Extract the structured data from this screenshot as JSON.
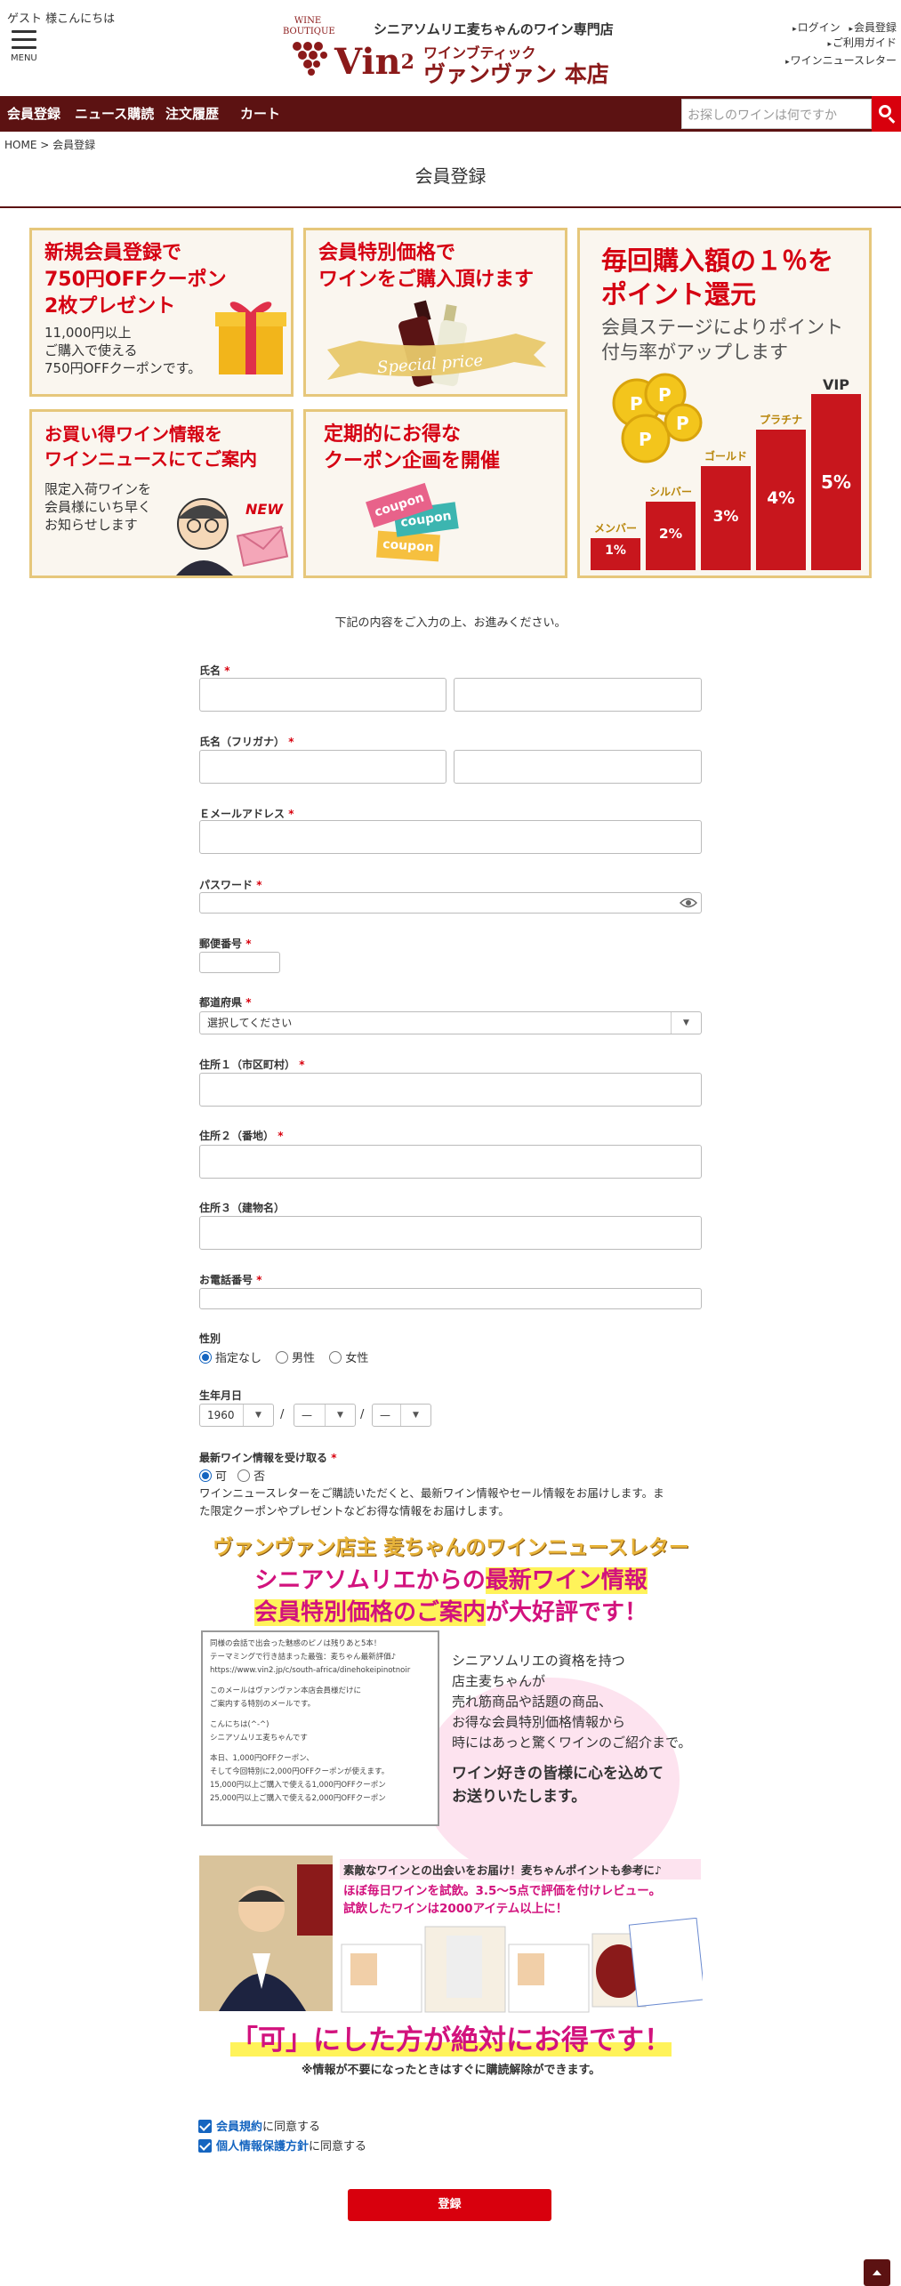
{
  "header": {
    "guest_greeting": "ゲスト 様こんにちは",
    "menu_label": "MENU",
    "logo": {
      "boutique": "WINE BOUTIQUE",
      "tagline": "シニアソムリエ麦ちゃんのワイン専門店",
      "brand": "Vin",
      "brand_sup": "2",
      "katakana": "ワインブティック",
      "shop_name": "ヴァンヴァン 本店"
    },
    "links": [
      "ログイン",
      "会員登録",
      "ご利用ガイド",
      "ワインニュースレター"
    ]
  },
  "navbar": {
    "items": [
      "会員登録",
      "ニュース購読",
      "注文履歴",
      "カート"
    ],
    "search_placeholder": "お探しのワインは何ですか"
  },
  "breadcrumb": "HOME > 会員登録",
  "page_title": "会員登録",
  "banners": {
    "coupon": {
      "h1": "新規会員登録で",
      "h2": "750円OFFクーポン",
      "h3": "2枚プレゼント",
      "s1": "11,000円以上",
      "s2": "ご購入で使える",
      "s3": "750円OFFクーポンです。"
    },
    "price": {
      "h1": "会員特別価格で",
      "h2": "ワインをご購入頂けます",
      "ribbon": "Special price"
    },
    "points": {
      "h1": "毎回購入額の１％を",
      "h2": "ポイント還元",
      "s1": "会員ステージによりポイント",
      "s2": "付与率がアップします",
      "stages": [
        {
          "name": "メンバー",
          "rate": "1%",
          "level": 0.18
        },
        {
          "name": "シルバー",
          "rate": "2%",
          "level": 0.38
        },
        {
          "name": "ゴールド",
          "rate": "3%",
          "level": 0.58
        },
        {
          "name": "プラチナ",
          "rate": "4%",
          "level": 0.78
        },
        {
          "name": "VIP",
          "rate": "5%",
          "level": 0.98
        }
      ]
    },
    "news": {
      "h1": "お買い得ワイン情報を",
      "h2": "ワインニュースにてご案内",
      "s1": "限定入荷ワインを",
      "s2": "会員様にいち早く",
      "s3": "お知らせします",
      "badge": "NEW"
    },
    "campaign": {
      "h1": "定期的にお得な",
      "h2": "クーポン企画を開催",
      "c1": "coupon",
      "c2": "coupon",
      "c3": "coupon"
    }
  },
  "form": {
    "intro": "下記の内容をご入力の上、お進みください。",
    "name_label": "氏名",
    "kana_label": "氏名（フリガナ）",
    "email_label": "Ｅメールアドレス",
    "password_label": "パスワード",
    "zip_label": "郵便番号",
    "pref_label": "都道府県",
    "pref_value": "選択してください",
    "addr1_label": "住所１（市区町村）",
    "addr2_label": "住所２（番地）",
    "addr3_label": "住所３（建物名）",
    "phone_label": "お電話番号",
    "required_mark": "*",
    "gender_label": "性別",
    "gender_options": [
      "指定なし",
      "男性",
      "女性"
    ],
    "birth_label": "生年月日",
    "birth_year": "1960",
    "birth_month": "—",
    "birth_day": "—",
    "birth_sep": "/",
    "news_label": "最新ワイン情報を受け取る",
    "news_options": [
      "可",
      "否"
    ],
    "news_desc1": "ワインニュースレターをご購読いただくと、最新ワイン情報やセール情報をお届けします。ま",
    "news_desc2": "た限定クーポンやプレゼントなどお得な情報をお届けします。"
  },
  "promo": {
    "title": "ヴァンヴァン店主 麦ちゃんのワインニュースレター",
    "line1a": "シニアソムリエからの",
    "line1b": "最新ワイン情報",
    "line2a": "会員特別価格のご案内",
    "line2b": "が大好評です！",
    "mail_lines": [
      "同様の会話で出会った魅惑のピノは残りあと5本！",
      "テーマミングで行き詰まった最強：麦ちゃん最新評価♪",
      "https://www.vin2.jp/c/south-africa/dinehokeipinotnoir",
      "このメールはヴァンヴァン本店会員様だけに",
      "ご案内する特別のメールです。",
      "こんにちは(^-^)",
      "シニアソムリエ麦ちゃんです",
      "本日、1,000円OFFクーポン、",
      "そして今回特別に2,000円OFFクーポンが使えます。",
      "15,000円以上ご購入で使える1,000円OFFクーポン",
      "25,000円以上ご購入で使える2,000円OFFクーポン"
    ],
    "desc": [
      "シニアソムリエの資格を持つ",
      "店主麦ちゃんが",
      "売れ筋商品や話題の商品、",
      "お得な会員特別価格情報から",
      "時にはあっと驚くワインのご紹介まで。"
    ],
    "desc_bold": [
      "ワイン好きの皆様に心を込めて",
      "お送りいたします。"
    ],
    "review_a": "素敵なワインとの出会いをお届け！麦ちゃんポイントも参考に♪",
    "review_b": "ほぼ毎日ワインを試飲。3.5～5点で評価を付けレビュー。",
    "review_c": "試飲したワインは2000アイテム以上に！",
    "big": "「可」にした方が絶対にお得です！",
    "note": "※情報が不要になったときはすぐに購読解除ができます。"
  },
  "agree": {
    "terms_link": "会員規約",
    "terms_rest": "に同意する",
    "privacy_link": "個人情報保護方針",
    "privacy_rest": "に同意する"
  },
  "submit_label": "登録",
  "colors": {
    "brand": "#5c1212",
    "accent": "#d8000d",
    "gold": "#e6c77b",
    "link": "#1565c0"
  }
}
